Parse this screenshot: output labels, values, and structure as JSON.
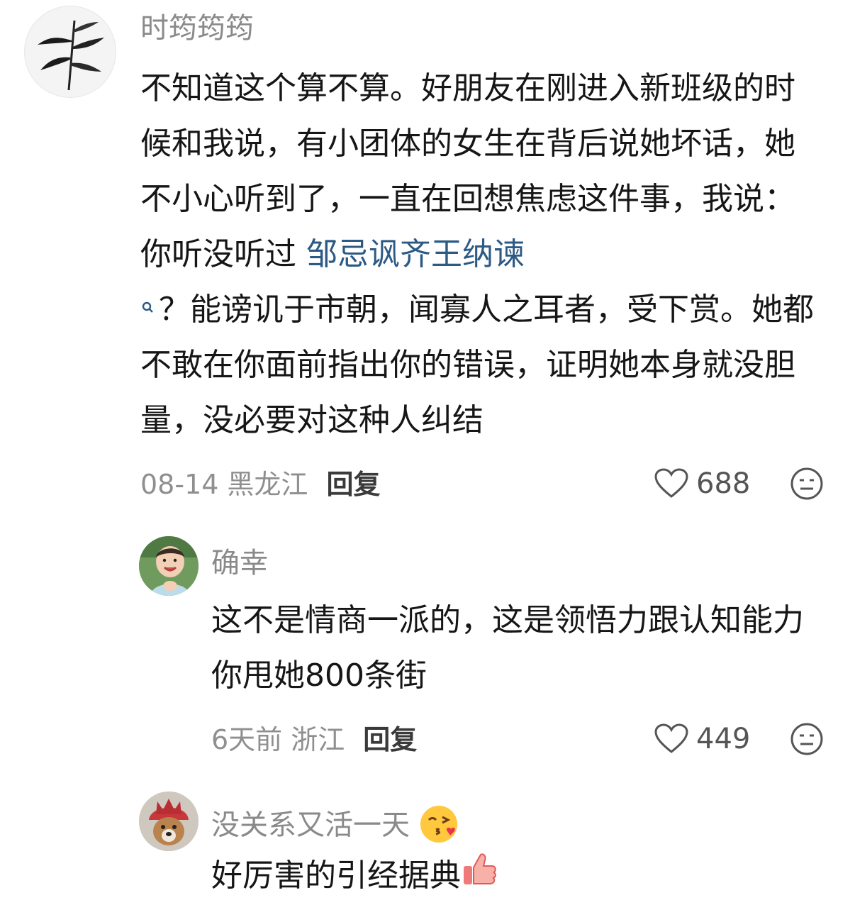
{
  "comments": [
    {
      "username": "时筠筠筠",
      "text_before_link": "不知道这个算不算。好朋友在刚进入新班级的时候和我说，有小团体的女生在背后说她坏话，她不小心听到了，一直在回想焦虑这件事，我说：你听没听过 ",
      "link_text": "邹忌讽齐王纳谏",
      "text_after_link": "？能谤讥于市朝，闻寡人之耳者，受下赏。她都不敢在你面前指出你的错误，证明她本身就没胆量，没必要对这种人纠结",
      "date": "08-14",
      "location": "黑龙江",
      "reply_label": "回复",
      "likes": "688"
    },
    {
      "username": "确幸",
      "text": "这不是情商一派的，这是领悟力跟认知能力你甩她800条街",
      "date": "6天前",
      "location": "浙江",
      "reply_label": "回复",
      "likes": "449"
    },
    {
      "username": "没关系又活一天",
      "text": "好厉害的引经据典"
    }
  ],
  "colors": {
    "link": "#2c5a85",
    "meta": "#8f8f8f",
    "username": "#8a8a8a"
  }
}
